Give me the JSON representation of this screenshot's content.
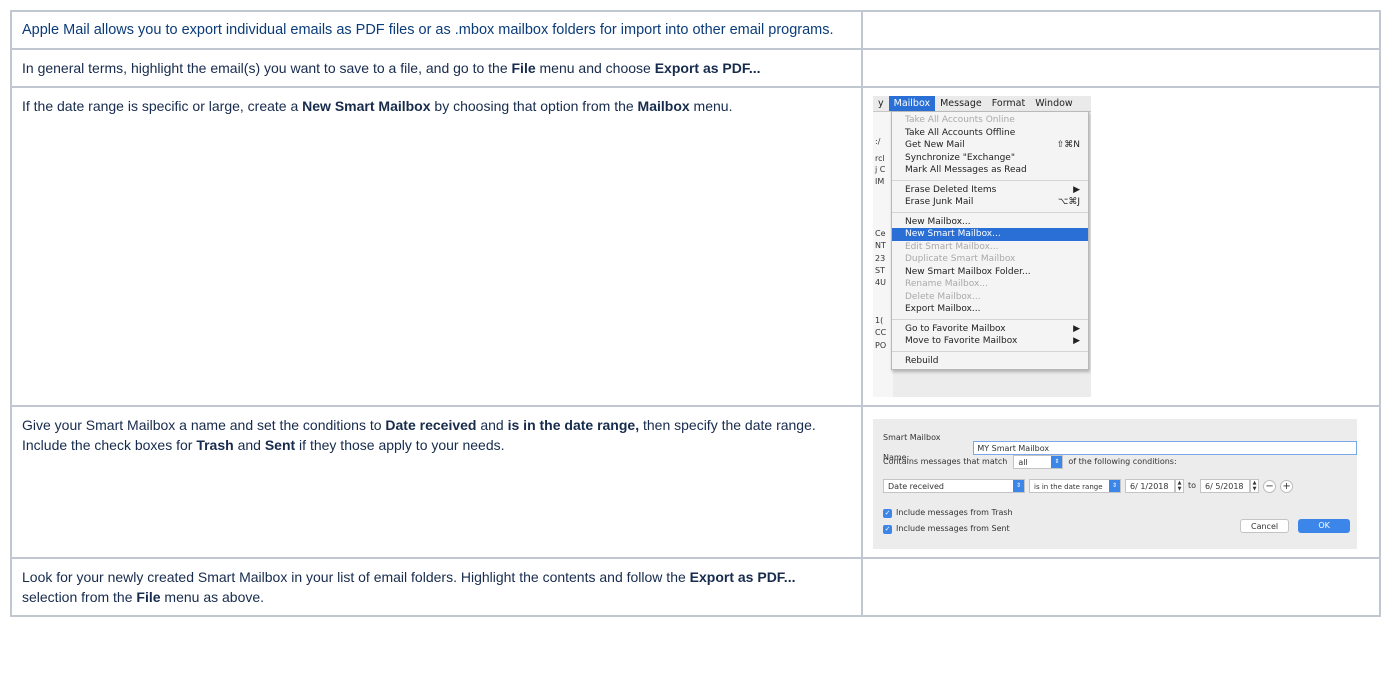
{
  "rows": [
    {
      "segments": [
        {
          "text": "Apple Mail allows you to export individual emails as PDF files or as .mbox mailbox folders for import into other email programs.",
          "bold": false
        }
      ]
    },
    {
      "segments": [
        {
          "text": "In general terms, highlight the email(s) you want to save to a file, and go to the ",
          "bold": false
        },
        {
          "text": "File",
          "bold": true
        },
        {
          "text": " menu and choose ",
          "bold": false
        },
        {
          "text": "Export as PDF...",
          "bold": true
        }
      ]
    },
    {
      "segments": [
        {
          "text": "If the date range is specific or large, create a ",
          "bold": false
        },
        {
          "text": "New Smart Mailbox",
          "bold": true
        },
        {
          "text": " by choosing that option from the ",
          "bold": false
        },
        {
          "text": "Mailbox",
          "bold": true
        },
        {
          "text": " menu.",
          "bold": false
        }
      ]
    },
    {
      "segments": [
        {
          "text": "Give your Smart Mailbox a name and set the conditions to ",
          "bold": false
        },
        {
          "text": "Date received",
          "bold": true
        },
        {
          "text": " and ",
          "bold": false
        },
        {
          "text": "is in the date range,",
          "bold": true
        },
        {
          "text": " then specify the date range. Include the check boxes for ",
          "bold": false
        },
        {
          "text": "Trash",
          "bold": true
        },
        {
          "text": " and ",
          "bold": false
        },
        {
          "text": "Sent",
          "bold": true
        },
        {
          "text": " if they those apply to your needs.",
          "bold": false
        }
      ]
    },
    {
      "segments": [
        {
          "text": "Look for your newly created Smart Mailbox in your list of email folders. Highlight the contents and follow the ",
          "bold": false
        },
        {
          "text": "Export as PDF...",
          "bold": true
        },
        {
          "text": " selection from the ",
          "bold": false
        },
        {
          "text": "File",
          "bold": true
        },
        {
          "text": " menu as above.",
          "bold": false
        }
      ]
    }
  ],
  "mac_menu": {
    "menubar": [
      "y",
      "Mailbox",
      "Message",
      "Format",
      "Window"
    ],
    "left_fragments": [
      ":/",
      "rcl",
      "j C",
      "IM",
      "Ce",
      "NT",
      "23",
      "ST",
      "4U",
      "1(",
      "CC",
      "PO"
    ],
    "items": [
      {
        "label": "Take All Accounts Online",
        "shortcut": "",
        "state": "disabled"
      },
      {
        "label": "Take All Accounts Offline",
        "shortcut": "",
        "state": "normal"
      },
      {
        "label": "Get New Mail",
        "shortcut": "⇧⌘N",
        "state": "normal"
      },
      {
        "label": "Synchronize \"Exchange\"",
        "shortcut": "",
        "state": "normal"
      },
      {
        "label": "Mark All Messages as Read",
        "shortcut": "",
        "state": "normal"
      },
      {
        "label": "---"
      },
      {
        "label": "Erase Deleted Items",
        "shortcut": "▶",
        "state": "normal"
      },
      {
        "label": "Erase Junk Mail",
        "shortcut": "⌥⌘J",
        "state": "normal"
      },
      {
        "label": "---"
      },
      {
        "label": "New Mailbox...",
        "shortcut": "",
        "state": "normal"
      },
      {
        "label": "New Smart Mailbox...",
        "shortcut": "",
        "state": "selected"
      },
      {
        "label": "Edit Smart Mailbox...",
        "shortcut": "",
        "state": "disabled"
      },
      {
        "label": "Duplicate Smart Mailbox",
        "shortcut": "",
        "state": "disabled"
      },
      {
        "label": "New Smart Mailbox Folder...",
        "shortcut": "",
        "state": "normal"
      },
      {
        "label": "Rename Mailbox...",
        "shortcut": "",
        "state": "disabled"
      },
      {
        "label": "Delete Mailbox...",
        "shortcut": "",
        "state": "disabled"
      },
      {
        "label": "Export Mailbox...",
        "shortcut": "",
        "state": "normal"
      },
      {
        "label": "---"
      },
      {
        "label": "Go to Favorite Mailbox",
        "shortcut": "▶",
        "state": "normal"
      },
      {
        "label": "Move to Favorite Mailbox",
        "shortcut": "▶",
        "state": "normal"
      },
      {
        "label": "---"
      },
      {
        "label": "Rebuild",
        "shortcut": "",
        "state": "normal"
      }
    ]
  },
  "smart_dialog": {
    "name_label": "Smart Mailbox Name:",
    "name_value": "MY Smart Mailbox",
    "contains_label": "Contains messages that match",
    "match_value": "all",
    "following_label": "of the following conditions:",
    "condition_field": "Date received",
    "condition_op": "is in the date range",
    "date_from": "6/ 1/2018",
    "to_label": "to",
    "date_to": "6/ 5/2018",
    "minus": "−",
    "plus": "+",
    "check_trash": "Include messages from Trash",
    "check_sent": "Include messages from Sent",
    "cancel": "Cancel",
    "ok": "OK"
  }
}
